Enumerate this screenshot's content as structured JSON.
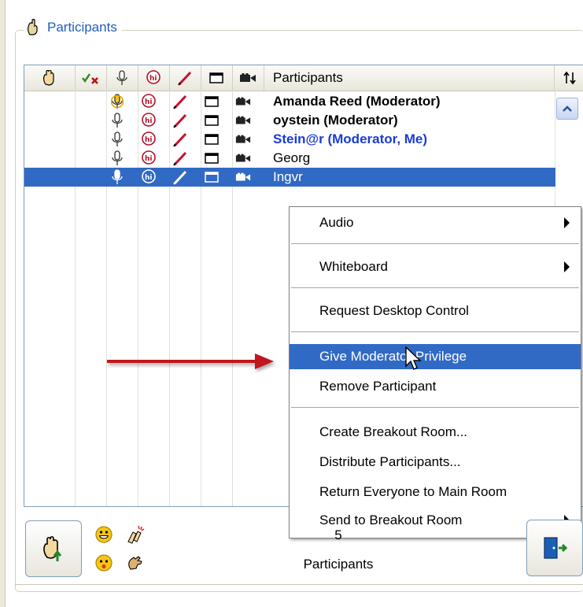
{
  "panel": {
    "title": "Participants"
  },
  "grid": {
    "column_header": "Participants",
    "rows": [
      {
        "name": "Amanda Reed (Moderator)",
        "bold": true,
        "color": "#000000",
        "mic_active": true,
        "selected": false
      },
      {
        "name": "oystein (Moderator)",
        "bold": true,
        "color": "#000000",
        "mic_active": false,
        "selected": false
      },
      {
        "name": "Stein@r (Moderator, Me)",
        "bold": true,
        "color": "#1a3cd6",
        "mic_active": false,
        "selected": false
      },
      {
        "name": "Georg",
        "bold": false,
        "color": "#000000",
        "mic_active": false,
        "selected": false
      },
      {
        "name": "Ingvr",
        "bold": false,
        "color": "#ffffff",
        "mic_active": false,
        "selected": true
      }
    ]
  },
  "context_menu": {
    "items": [
      {
        "label": "Audio",
        "submenu": true
      },
      {
        "label": "Whiteboard",
        "submenu": true
      },
      {
        "label": "Request Desktop Control",
        "submenu": false
      },
      {
        "label": "Give Moderator Privilege",
        "submenu": false,
        "highlighted": true
      },
      {
        "label": "Remove Participant",
        "submenu": false
      },
      {
        "label": "Create Breakout Room...",
        "submenu": false
      },
      {
        "label": "Distribute Participants...",
        "submenu": false
      },
      {
        "label": "Return Everyone to Main Room",
        "submenu": false
      },
      {
        "label": "Send to Breakout Room",
        "submenu": true
      }
    ]
  },
  "footer": {
    "count": "5",
    "count_label": "Participants"
  },
  "colors": {
    "selection": "#316ac5",
    "annotation_arrow": "#c0141b",
    "title_blue": "#1f5fbf"
  }
}
